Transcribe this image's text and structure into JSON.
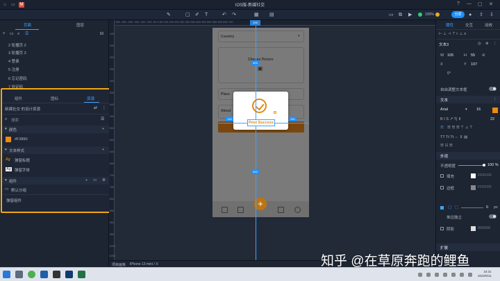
{
  "title": "IOS版-新媒社交",
  "window_controls": [
    "?",
    "—",
    "▢",
    "✕"
  ],
  "toolbar": {
    "zoom": "100%",
    "share_label": "分享",
    "undo": "↶",
    "redo": "↷",
    "play": "▶"
  },
  "left_panel": {
    "tabs": [
      "页面",
      "图层"
    ],
    "pages": [
      "2 轮播页 2",
      "3 轮播页 3",
      "4 登录",
      "5 注册",
      "6 忘记密码",
      "7 验证码"
    ],
    "library_tabs": [
      "组件",
      "图标",
      "资源"
    ],
    "library_title": "新媒社交 的设计资源",
    "search_placeholder": "搜索",
    "sections": {
      "colors": "颜色",
      "text_styles": "文本样式",
      "components": "组件"
    },
    "color_items": [
      {
        "name": "#F3890",
        "hex": "#F08A10"
      }
    ],
    "text_items": [
      "弹窗标题",
      "弹窗字体"
    ],
    "component_groups": [
      "默认分组"
    ],
    "component_items": [
      "弹窗组件"
    ]
  },
  "ruler_h": "-350  -300  -250  -200  -150  -100  -50   0    50   100  150  200  250  300  350  400  450  500  550  600  650  700",
  "ruler_h_mark": "100",
  "ruler_v": [
    "100",
    "150",
    "200",
    "250",
    "300",
    "350",
    "400",
    "450",
    "500",
    "550",
    "600",
    "650",
    "700",
    "750",
    "800",
    "850",
    "900",
    "950",
    "1000",
    "1050"
  ],
  "phone": {
    "country_label": "Country",
    "picture_label": "Choose Picture",
    "place_label": "Place",
    "about_label": "About"
  },
  "dialog": {
    "post_text": "Post Success"
  },
  "measure_tags": {
    "top": "404",
    "left": "148",
    "right": "150",
    "bottom": "253"
  },
  "right_panel": {
    "tabs": [
      "属性",
      "交互",
      "动效"
    ],
    "layer_name": "文本3",
    "w_label": "W",
    "w_value": "105",
    "h_label": "H",
    "h_value": "55",
    "x_label": "X",
    "x_value": "",
    "y_label": "Y",
    "y_value": "107",
    "r_value": "0°",
    "auto_height": "自由调整文本框",
    "text_section": "文本",
    "font_name": "Arial",
    "font_size": "16",
    "line_height": "22",
    "appearance_section": "外观",
    "opacity_label": "不透明度",
    "opacity_value": "100 %",
    "fill_label": "填充",
    "fill_hex": "FFFFFF",
    "stroke_label": "边框",
    "stroke_hex": "FFFFFF",
    "stroke_width": "0",
    "stroke_unit": "px",
    "indep_corner": "单边独立",
    "shadow_label": "阴影",
    "shadow_hex": "000000",
    "expand_section": "扩展"
  },
  "statusbar": {
    "project": "项目画板",
    "device": "iPhone 13 mini / X"
  },
  "taskbar_time": "15:31",
  "taskbar_date": "2022/6/11",
  "watermark": "知乎 @在草原奔跑的鲤鱼",
  "colors": {
    "accent": "#1E90FF",
    "highlight_border": "#F0A716",
    "brand_orange": "#F08A10",
    "brown_button": "#7A4710"
  }
}
